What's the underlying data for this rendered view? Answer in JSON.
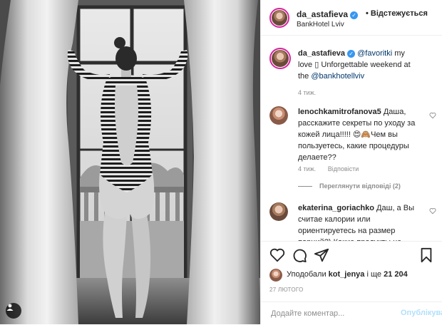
{
  "post": {
    "author": "da_astafieva",
    "follow_label": "Відстежується",
    "separator": "•",
    "location": "BankHotel Lviv",
    "verified_mark": "✓"
  },
  "caption": {
    "username": "da_astafieva",
    "mention_1": "@favoritki",
    "text_1": " my love ",
    "emoji_box": "▯",
    "text_2": " Unforgettable weekend at the ",
    "mention_2": "@bankhotellviv",
    "time": "4 тиж."
  },
  "comments": [
    {
      "username": "lenochkamitrofanova5",
      "text": " Даша, расскажите секреты по уходу за кожей лица!!!!! 😍🙈Чем вы пользуетесь, какие процедуры делаете??",
      "time": "4 тиж.",
      "reply_label": "Відповісти",
      "view_replies": "Переглянути відповіді (2)"
    },
    {
      "username": "ekaterina_goriachko",
      "text": " Даш, а Вы считае калории или ориентируетесь на размер порций?) Какие продукты не"
    }
  ],
  "likes": {
    "prefix": "Уподобали ",
    "user": "kot_jenya",
    "suffix": " і ще ",
    "count": "21 204"
  },
  "date": "27 ЛЮТОГО",
  "add_comment": {
    "placeholder": "Додайте коментар...",
    "publish_label": "Опублікувати"
  },
  "icons": {
    "like": "heart-icon",
    "comment": "comment-icon",
    "share": "paper-plane-icon",
    "save": "bookmark-icon",
    "comment_like": "small-heart-icon",
    "tagged_users": "user-tag-icon"
  },
  "colors": {
    "link": "#00376b",
    "verified": "#3897f0",
    "publish_disabled": "#b2dffc",
    "muted": "#8e8e8e",
    "story_ring": "#d6249f"
  }
}
